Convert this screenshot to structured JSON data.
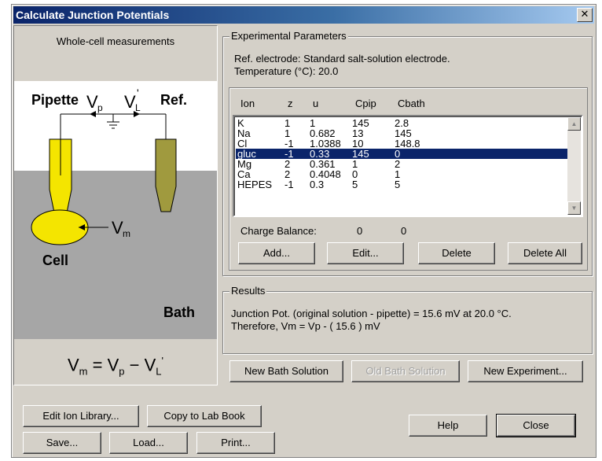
{
  "window": {
    "title": "Calculate Junction Potentials",
    "close_glyph": "✕"
  },
  "left": {
    "header": "Whole-cell measurements",
    "diagram": {
      "pipette": "Pipette",
      "ref": "Ref.",
      "vp": "V",
      "vp_sub": "p",
      "vl": "V",
      "vl_sub": "L",
      "vl_prime": "'",
      "vm": "V",
      "vm_sub": "m",
      "cell": "Cell",
      "bath": "Bath",
      "colors": {
        "bath": "#a6a6a6",
        "pipette": "#f4e500",
        "ref": "#a09a3e"
      }
    },
    "formula": {
      "v": "V",
      "m": "m",
      "eq": " = ",
      "p": "p",
      "minus": " − ",
      "l": "L",
      "prime": "'"
    }
  },
  "experimental": {
    "label": "Experimental Parameters",
    "ref_electrode": "Ref. electrode: Standard salt-solution electrode.",
    "temperature": "Temperature (°C): 20.0"
  },
  "table": {
    "headers": [
      "Ion",
      "z",
      "u",
      "Cpip",
      "Cbath"
    ],
    "rows": [
      [
        "K",
        "1",
        "1",
        "145",
        "2.8"
      ],
      [
        "Na",
        "1",
        "0.682",
        "13",
        "145"
      ],
      [
        "Cl",
        "-1",
        "1.0388",
        "10",
        "148.8"
      ],
      [
        "gluc",
        "-1",
        "0.33",
        "145",
        "0"
      ],
      [
        "Mg",
        "2",
        "0.361",
        "1",
        "2"
      ],
      [
        "Ca",
        "2",
        "0.4048",
        "0",
        "1"
      ],
      [
        "HEPES",
        "-1",
        "0.3",
        "5",
        "5"
      ]
    ],
    "selected_row": 3,
    "charge_balance_label": "Charge Balance:",
    "charge_balance_pip": "0",
    "charge_balance_bath": "0"
  },
  "list_buttons": {
    "add": "Add...",
    "edit": "Edit...",
    "delete": "Delete",
    "delete_all": "Delete All"
  },
  "results": {
    "label": "Results",
    "line1": "Junction Pot. (original solution - pipette) = 15.6 mV at 20.0 °C.",
    "line2": "Therefore, Vm = Vp - ( 15.6 ) mV"
  },
  "solution_buttons": {
    "new_bath": "New Bath Solution",
    "old_bath": "Old Bath Solution",
    "new_experiment": "New Experiment..."
  },
  "bottom_buttons": {
    "edit_ion_library": "Edit Ion Library...",
    "copy_to_lab_book": "Copy to Lab Book",
    "save": "Save...",
    "load": "Load...",
    "print": "Print...",
    "help": "Help",
    "close": "Close"
  },
  "scroll": {
    "up": "▲",
    "down": "▼"
  }
}
